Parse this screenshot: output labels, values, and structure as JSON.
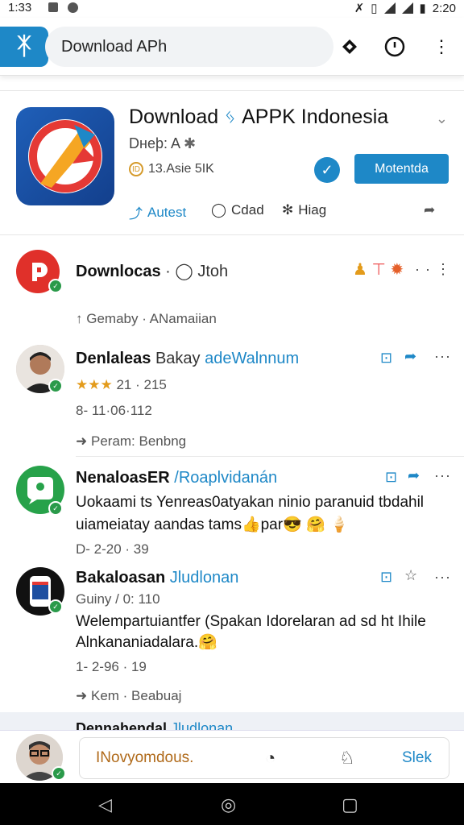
{
  "status_bar": {
    "time": "1:33",
    "right_time": "2:20"
  },
  "address_bar": {
    "logo_glyph": "ᛡ",
    "url_text": "Download APh",
    "icons": [
      "diamond-icon",
      "clock-icon",
      "more-vert-icon"
    ]
  },
  "app": {
    "title": "Download",
    "title_glyph": "ᛃ",
    "title_rest": "APPK Indonesia",
    "subtitle": "Dнeþ: A",
    "size": "13.Asie 5IK",
    "install_label": "Motentda",
    "actions": [
      {
        "icon": "share-icon",
        "label": "Autest"
      },
      {
        "icon": "chat-icon",
        "label": "Cdad"
      },
      {
        "icon": "puzzle-icon",
        "label": "Hiag"
      }
    ]
  },
  "header_post": {
    "name": "Downlocas",
    "separator": "·",
    "handle": "Jtoh",
    "meta_arrow": "↑",
    "meta": "Gemaby · ANamaiian"
  },
  "posts": [
    {
      "name": "Denlaleas",
      "name_plain": "Bakay",
      "name_sub": "adeWalnnum",
      "stars": "★★★",
      "rating": "21 · 215",
      "timestamp": "8- 11·06·112",
      "footer": "Peram: Benbng",
      "avatar": "person-photo"
    },
    {
      "name": "NenaloasER",
      "name_sub": "/Roaplvidanán",
      "line1": "Uokaami ts Yenreas0atyakan ninio paranuid tbdahil",
      "line2": "uiameiatay aandas tams",
      "line2_emoji": "👍par😎 🤗 🍦",
      "timestamp": "D- 2-20 · 39",
      "avatar": "green-speech-icon"
    },
    {
      "name": "Bakaloasan",
      "name_sub": "Jludlonan",
      "meta": "Guiny / 0: 110",
      "line1": "Welempartuiantfer (Spakan Idorelaran ad sd ht Ihile",
      "line2": "Alnkananiadalara.",
      "line2_emoji": "🤗",
      "timestamp": "1- 2-96 · 19",
      "footer": "Kem · Beabuaj",
      "avatar": "phone-icon"
    }
  ],
  "peek_post": {
    "name": "Dennahendal",
    "name_sub": "Jludlonan"
  },
  "composer": {
    "placeholder": "INovyomdous.",
    "send_label": "Slek"
  },
  "colors": {
    "accent": "#1e88c7",
    "star": "#e39b1b",
    "verified_green": "#2a9a4a"
  }
}
